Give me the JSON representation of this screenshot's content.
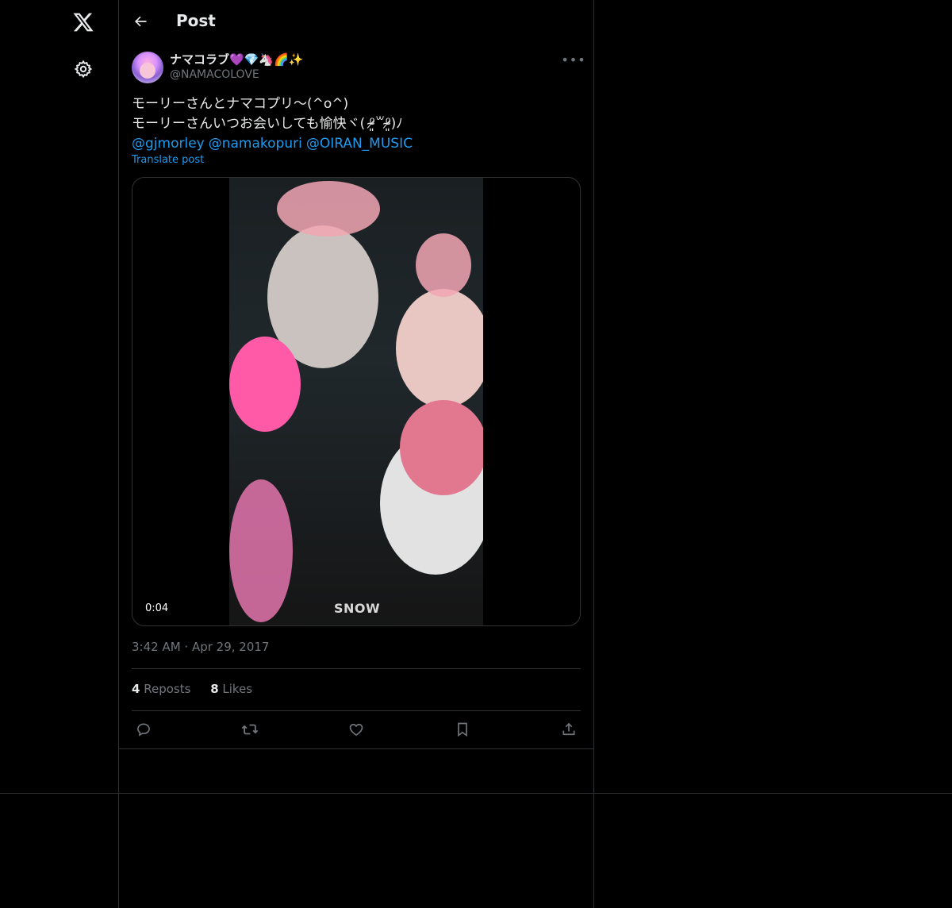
{
  "header": {
    "title": "Post"
  },
  "post": {
    "display_name": "ナマコラブ💜💎🦄🌈✨",
    "handle": "@NAMACOLOVE",
    "text_line1": "モーリーさんとナマコプリ〜(^o^)",
    "text_line2": "モーリーさんいつお会いしても愉快ヾ( ⁰̷̴͈꒳⁰̷̴͈)ﾉ",
    "mentions": [
      "@gjmorley",
      "@namakopuri",
      "@OIRAN_MUSIC"
    ],
    "translate_label": "Translate post",
    "video_duration": "0:04",
    "video_watermark": "SNOW",
    "timestamp": "3:42 AM · Apr 29, 2017",
    "reposts_count": "4",
    "reposts_label": "Reposts",
    "likes_count": "8",
    "likes_label": "Likes"
  },
  "icons": {
    "logo": "x-logo-icon",
    "settings": "gear-icon",
    "back": "arrow-left-icon",
    "more": "more-icon",
    "reply": "reply-icon",
    "repost": "repost-icon",
    "like": "heart-icon",
    "bookmark": "bookmark-icon",
    "share": "share-icon"
  },
  "colors": {
    "background": "#000000",
    "text": "#e7e9ea",
    "secondary": "#71767b",
    "accent": "#1d9bf0",
    "border": "#2f3336"
  }
}
